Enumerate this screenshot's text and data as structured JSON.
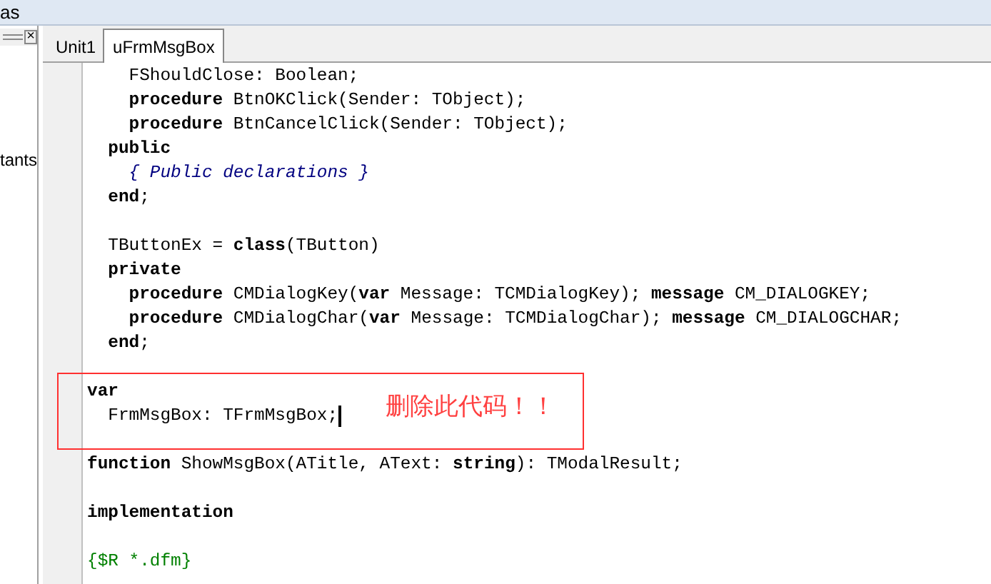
{
  "window": {
    "title": "as"
  },
  "side_panel": {
    "close": "×",
    "items": [
      "tants"
    ]
  },
  "tabs": [
    {
      "label": "Unit1",
      "selected": false
    },
    {
      "label": "uFrmMsgBox",
      "selected": true
    }
  ],
  "code": [
    {
      "kind": "code",
      "segments": [
        {
          "kind": "plain",
          "text": "    FShouldClose: Boolean;"
        }
      ]
    },
    {
      "kind": "code",
      "segments": [
        {
          "kind": "keyword",
          "text": "    procedure"
        },
        {
          "kind": "plain",
          "text": " BtnOKClick(Sender: TObject);"
        }
      ]
    },
    {
      "kind": "code",
      "segments": [
        {
          "kind": "keyword",
          "text": "    procedure"
        },
        {
          "kind": "plain",
          "text": " BtnCancelClick(Sender: TObject);"
        }
      ]
    },
    {
      "kind": "code",
      "segments": [
        {
          "kind": "keyword",
          "text": "  public"
        }
      ]
    },
    {
      "kind": "code",
      "segments": [
        {
          "kind": "comment",
          "text": "    { Public declarations }"
        }
      ]
    },
    {
      "kind": "code",
      "segments": [
        {
          "kind": "keyword",
          "text": "  end"
        },
        {
          "kind": "plain",
          "text": ";"
        }
      ]
    },
    {
      "kind": "blank"
    },
    {
      "kind": "code",
      "segments": [
        {
          "kind": "plain",
          "text": "  TButtonEx = "
        },
        {
          "kind": "keyword",
          "text": "class"
        },
        {
          "kind": "plain",
          "text": "(TButton)"
        }
      ]
    },
    {
      "kind": "code",
      "segments": [
        {
          "kind": "keyword",
          "text": "  private"
        }
      ]
    },
    {
      "kind": "code",
      "segments": [
        {
          "kind": "keyword",
          "text": "    procedure"
        },
        {
          "kind": "plain",
          "text": " CMDialogKey("
        },
        {
          "kind": "keyword",
          "text": "var"
        },
        {
          "kind": "plain",
          "text": " Message: TCMDialogKey); "
        },
        {
          "kind": "keyword",
          "text": "message"
        },
        {
          "kind": "plain",
          "text": " CM_DIALOGKEY;"
        }
      ]
    },
    {
      "kind": "code",
      "segments": [
        {
          "kind": "keyword",
          "text": "    procedure"
        },
        {
          "kind": "plain",
          "text": " CMDialogChar("
        },
        {
          "kind": "keyword",
          "text": "var"
        },
        {
          "kind": "plain",
          "text": " Message: TCMDialogChar); "
        },
        {
          "kind": "keyword",
          "text": "message"
        },
        {
          "kind": "plain",
          "text": " CM_DIALOGCHAR;"
        }
      ]
    },
    {
      "kind": "code",
      "segments": [
        {
          "kind": "keyword",
          "text": "  end"
        },
        {
          "kind": "plain",
          "text": ";"
        }
      ]
    },
    {
      "kind": "blank"
    },
    {
      "kind": "code",
      "segments": [
        {
          "kind": "keyword",
          "text": "var"
        }
      ]
    },
    {
      "kind": "code",
      "cursor": true,
      "segments": [
        {
          "kind": "plain",
          "text": "  FrmMsgBox: TFrmMsgBox;"
        }
      ]
    },
    {
      "kind": "blank"
    },
    {
      "kind": "code",
      "segments": [
        {
          "kind": "keyword",
          "text": "function"
        },
        {
          "kind": "plain",
          "text": " ShowMsgBox(ATitle, AText: "
        },
        {
          "kind": "keyword",
          "text": "string"
        },
        {
          "kind": "plain",
          "text": "): TModalResult;"
        }
      ]
    },
    {
      "kind": "blank"
    },
    {
      "kind": "code",
      "segments": [
        {
          "kind": "keyword",
          "text": "implementation"
        }
      ]
    },
    {
      "kind": "blank"
    },
    {
      "kind": "code",
      "segments": [
        {
          "kind": "directive",
          "text": "{$R *.dfm}"
        }
      ]
    }
  ],
  "annotation": {
    "text": "删除此代码！！"
  }
}
